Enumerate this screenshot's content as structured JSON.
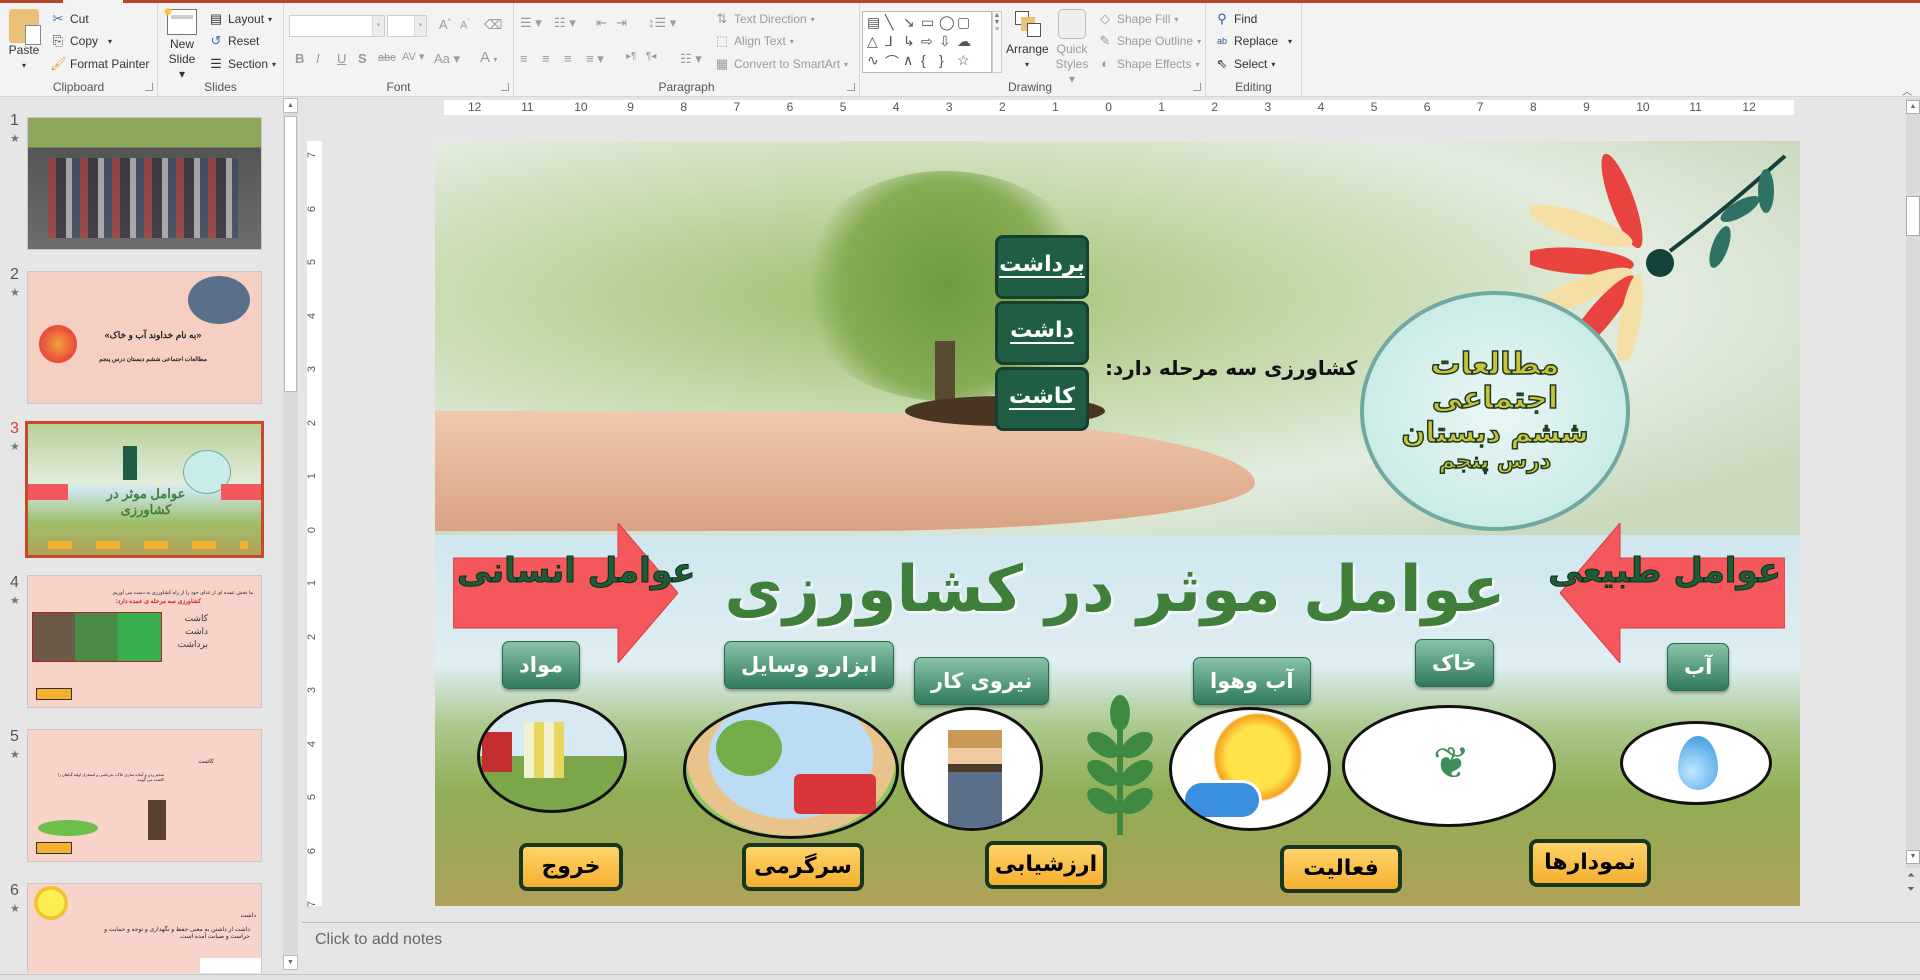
{
  "app": {
    "accent": "#b7472a"
  },
  "ribbon": {
    "clipboard": {
      "label": "Clipboard",
      "paste": "Paste",
      "cut": "Cut",
      "copy": "Copy",
      "format_painter": "Format Painter"
    },
    "slides": {
      "label": "Slides",
      "new_slide_l1": "New",
      "new_slide_l2": "Slide",
      "layout": "Layout",
      "reset": "Reset",
      "section": "Section"
    },
    "font": {
      "label": "Font",
      "font_name": "",
      "font_size": "",
      "bold": "B",
      "italic": "I",
      "underline": "U",
      "shadow": "S",
      "strikethrough": "abc",
      "spacing": "AV",
      "change_case": "Aa",
      "font_color": "A",
      "grow": "A",
      "shrink": "A"
    },
    "paragraph": {
      "label": "Paragraph",
      "text_direction": "Text Direction",
      "align_text": "Align Text",
      "convert_smartart": "Convert to SmartArt"
    },
    "drawing": {
      "label": "Drawing",
      "arrange": "Arrange",
      "quick_styles_l1": "Quick",
      "quick_styles_l2": "Styles",
      "shape_fill": "Shape Fill",
      "shape_outline": "Shape Outline",
      "shape_effects": "Shape Effects",
      "shapes": [
        "▤",
        "╲",
        "↘",
        "▭",
        "◯",
        "▢",
        "△",
        "⅃",
        "↳",
        "⇨",
        "⇩",
        "☁",
        "∿",
        "⌒",
        "∧",
        "{",
        "}",
        "☆"
      ]
    },
    "editing": {
      "label": "Editing",
      "find": "Find",
      "replace": "Replace",
      "select": "Select"
    }
  },
  "thumbnails": [
    {
      "number": "1",
      "star": "★",
      "description": "Schoolyard photo with students"
    },
    {
      "number": "2",
      "star": "★",
      "title": "«به نام خداوند آب و خاک»",
      "subtitle": "مطالعات اجتماعی ششم دبستان درس پنجم"
    },
    {
      "number": "3",
      "star": "★",
      "selected": true,
      "description": "Current slide"
    },
    {
      "number": "4",
      "star": "★",
      "line1": "ما بخش عمده ای از غذای خود را از راه کشاورزی به دست می آوریم.",
      "line2": "کشاورزی سه مرحله ی عمده دارد:",
      "bullets": [
        "کاشت",
        "داشت",
        "برداشت"
      ]
    },
    {
      "number": "5",
      "star": "★",
      "heading": "کاشت",
      "text": "شخم زدن و آماده سازی خاک، بذرپاشی و استقرار اولیه گیاهان را کاشت می گویند."
    },
    {
      "number": "6",
      "star": "★",
      "heading": "داشت",
      "text": "داشت از داشتن به معنی حفظ و نگهداری و توجه و حمایت و حراست و صیانت آمده است."
    }
  ],
  "ruler": {
    "horizontal": [
      "12",
      "11",
      "10",
      "9",
      "8",
      "7",
      "6",
      "5",
      "4",
      "3",
      "2",
      "1",
      "0",
      "1",
      "2",
      "3",
      "4",
      "5",
      "6",
      "7",
      "8",
      "9",
      "10",
      "11",
      "12"
    ],
    "vertical": [
      "7",
      "6",
      "5",
      "4",
      "3",
      "2",
      "1",
      "0",
      "1",
      "2",
      "3",
      "4",
      "5",
      "6",
      "7"
    ]
  },
  "slide": {
    "stages_caption": "کشاورزی سه مرحله دارد:",
    "stages": [
      "برداشت",
      "داشت",
      "کاشت"
    ],
    "title_circle": [
      "مطالعات",
      "اجتماعی",
      "ششم دبستان",
      "درس پنجم"
    ],
    "main_title": "عوامل موثر در کشاورزی",
    "natural_factors_arrow": "عوامل طبیعی",
    "human_factors_arrow": "عوامل انسانی",
    "factors": {
      "water": "آب",
      "soil": "خاک",
      "climate": "آب وهوا",
      "labor": "نیروی کار",
      "tools": "ابزارو وسایل",
      "materials": "مواد"
    },
    "nav_buttons": {
      "charts": "نمودارها",
      "activity": "فعالیت",
      "evaluation": "ارزشیابی",
      "entertainment": "سرگرمی",
      "exit": "خروج"
    }
  },
  "notes": {
    "placeholder": "Click to add notes"
  }
}
